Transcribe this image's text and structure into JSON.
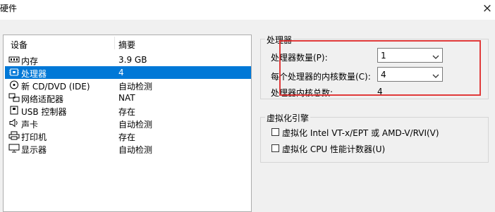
{
  "window": {
    "title": "硬件",
    "close_glyph": "×"
  },
  "device_list": {
    "columns": [
      "设备",
      "摘要"
    ],
    "items": [
      {
        "name": "内存",
        "summary": "3.9 GB",
        "icon": "memory-icon",
        "selected": false
      },
      {
        "name": "处理器",
        "summary": "4",
        "icon": "processor-icon",
        "selected": true
      },
      {
        "name": "新 CD/DVD (IDE)",
        "summary": "自动检测",
        "icon": "cd-dvd-icon",
        "selected": false
      },
      {
        "name": "网络适配器",
        "summary": "NAT",
        "icon": "network-adapter-icon",
        "selected": false
      },
      {
        "name": "USB 控制器",
        "summary": "存在",
        "icon": "usb-icon",
        "selected": false
      },
      {
        "name": "声卡",
        "summary": "自动检测",
        "icon": "speaker-icon",
        "selected": false
      },
      {
        "name": "打印机",
        "summary": "存在",
        "icon": "printer-icon",
        "selected": false
      },
      {
        "name": "显示器",
        "summary": "自动检测",
        "icon": "monitor-icon",
        "selected": false
      }
    ]
  },
  "processor": {
    "group_title": "处理器",
    "count_label": "处理器数量(P):",
    "count_value": "1",
    "cores_label": "每个处理器的内核数量(C):",
    "cores_value": "4",
    "total_label": "处理器内核总数:",
    "total_value": "4"
  },
  "virtualization": {
    "group_title": "虚拟化引擎",
    "vtx_label": "虚拟化 Intel VT-x/EPT 或 AMD-V/RVI(V)",
    "vtx_checked": false,
    "perf_label": "虚拟化 CPU 性能计数器(U)",
    "perf_checked": false
  },
  "colors": {
    "selection": "#0078d7",
    "annotation": "#e03a3a"
  }
}
